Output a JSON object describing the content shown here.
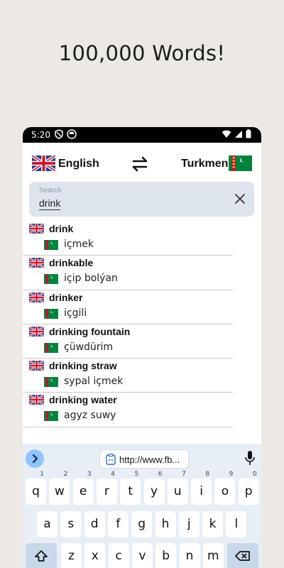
{
  "promo": {
    "headline": "100,000 Words!"
  },
  "status_bar": {
    "time": "5:20"
  },
  "languages": {
    "source": "English",
    "target": "Turkmen"
  },
  "search": {
    "label": "Search",
    "value": "drink"
  },
  "results": [
    {
      "term": "drink",
      "translation": "içmek"
    },
    {
      "term": "drinkable",
      "translation": "içip bolýan"
    },
    {
      "term": "drinker",
      "translation": "içgili"
    },
    {
      "term": "drinking fountain",
      "translation": "çüwdürim"
    },
    {
      "term": "drinking straw",
      "translation": "sypal içmek"
    },
    {
      "term": "drinking water",
      "translation": "agyz suwy"
    }
  ],
  "keyboard": {
    "url_suggestion": "http://www.fb...",
    "row1": [
      {
        "k": "q",
        "h": "1"
      },
      {
        "k": "w",
        "h": "2"
      },
      {
        "k": "e",
        "h": "3"
      },
      {
        "k": "r",
        "h": "4"
      },
      {
        "k": "t",
        "h": "5"
      },
      {
        "k": "y",
        "h": "6"
      },
      {
        "k": "u",
        "h": "7"
      },
      {
        "k": "i",
        "h": "8"
      },
      {
        "k": "o",
        "h": "9"
      },
      {
        "k": "p",
        "h": "0"
      }
    ],
    "row2": [
      "a",
      "s",
      "d",
      "f",
      "g",
      "h",
      "j",
      "k",
      "l"
    ],
    "row3": [
      "z",
      "x",
      "c",
      "v",
      "b",
      "n",
      "m"
    ]
  },
  "colors": {
    "accent": "#8ec5ff",
    "search_bg": "#dde4ee",
    "keyboard_bg": "#e8eef5"
  }
}
